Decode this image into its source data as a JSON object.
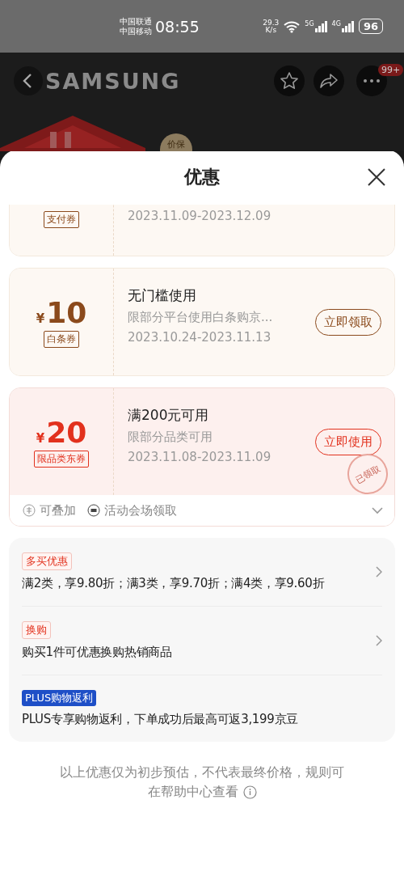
{
  "status_bar": {
    "carriers": [
      "中国联通",
      "中国移动"
    ],
    "time": "08:55",
    "net_speed": [
      "29.3",
      "K/s"
    ],
    "signals": [
      "5G",
      "4G"
    ],
    "battery": "96"
  },
  "page_header": {
    "logo": "SAMSUNG",
    "badge": "99+",
    "price_badge": "价保"
  },
  "sheet": {
    "title": "优惠"
  },
  "coupons": [
    {
      "color": "#8b4a1c",
      "tag": "支付券",
      "date": "2023.11.09-2023.12.09",
      "claimed": false
    },
    {
      "color": "#8b4a1c",
      "currency": "¥",
      "amount": "10",
      "tag": "白条券",
      "title": "无门槛使用",
      "desc": "限部分平台使用白条购京...",
      "date": "2023.10.24-2023.11.13",
      "button": "立即领取",
      "claimed": false
    },
    {
      "color": "#e2311d",
      "currency": "¥",
      "amount": "20",
      "tag": "限品类东券",
      "title": "满200元可用",
      "desc": "限部分品类可用",
      "date": "2023.11.08-2023.11.09",
      "button": "立即使用",
      "claimed": true,
      "stamp": "已领取",
      "footer": [
        {
          "kind": "stack",
          "text": "可叠加"
        },
        {
          "kind": "venue",
          "text": "活动会场领取"
        }
      ]
    }
  ],
  "promos": [
    {
      "kind": "outline",
      "tag": "多买优惠",
      "text": "满2类，享9.80折；满3类，享9.70折；满4类，享9.60折",
      "arrow": true
    },
    {
      "kind": "outline",
      "tag": "换购",
      "text": "购买1件可优惠换购热销商品",
      "arrow": true
    },
    {
      "kind": "filled",
      "tag": "PLUS购物返利",
      "text": "PLUS专享购物返利，下单成功后最高可返3,199京豆",
      "arrow": false
    }
  ],
  "footer_note": [
    "以上优惠仅为初步预估，不代表最终价格，规则可",
    "在帮助中心查看"
  ]
}
